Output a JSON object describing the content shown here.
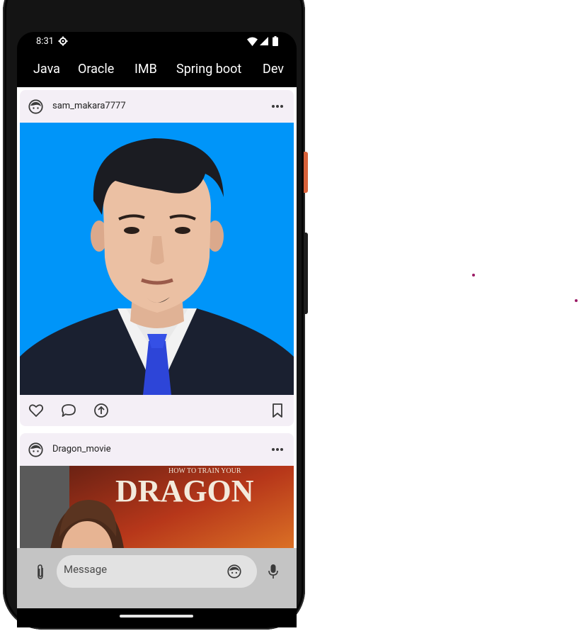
{
  "status_bar": {
    "time": "8:31"
  },
  "tabs": [
    "Java",
    "Oracle",
    "IMB",
    "Spring boot",
    "Dev"
  ],
  "feed": {
    "posts": [
      {
        "username": "sam_makara7777"
      },
      {
        "username": "Dragon_movie",
        "poster_title": "DRAGON",
        "poster_tagline": "HOW TO TRAIN YOUR"
      }
    ]
  },
  "compose": {
    "placeholder": "Message"
  },
  "colors": {
    "card_background": "#f4eff6",
    "photo_background": "#0095f9",
    "compose_bar": "#c4c4c4",
    "compose_field": "#e2e2e2"
  }
}
